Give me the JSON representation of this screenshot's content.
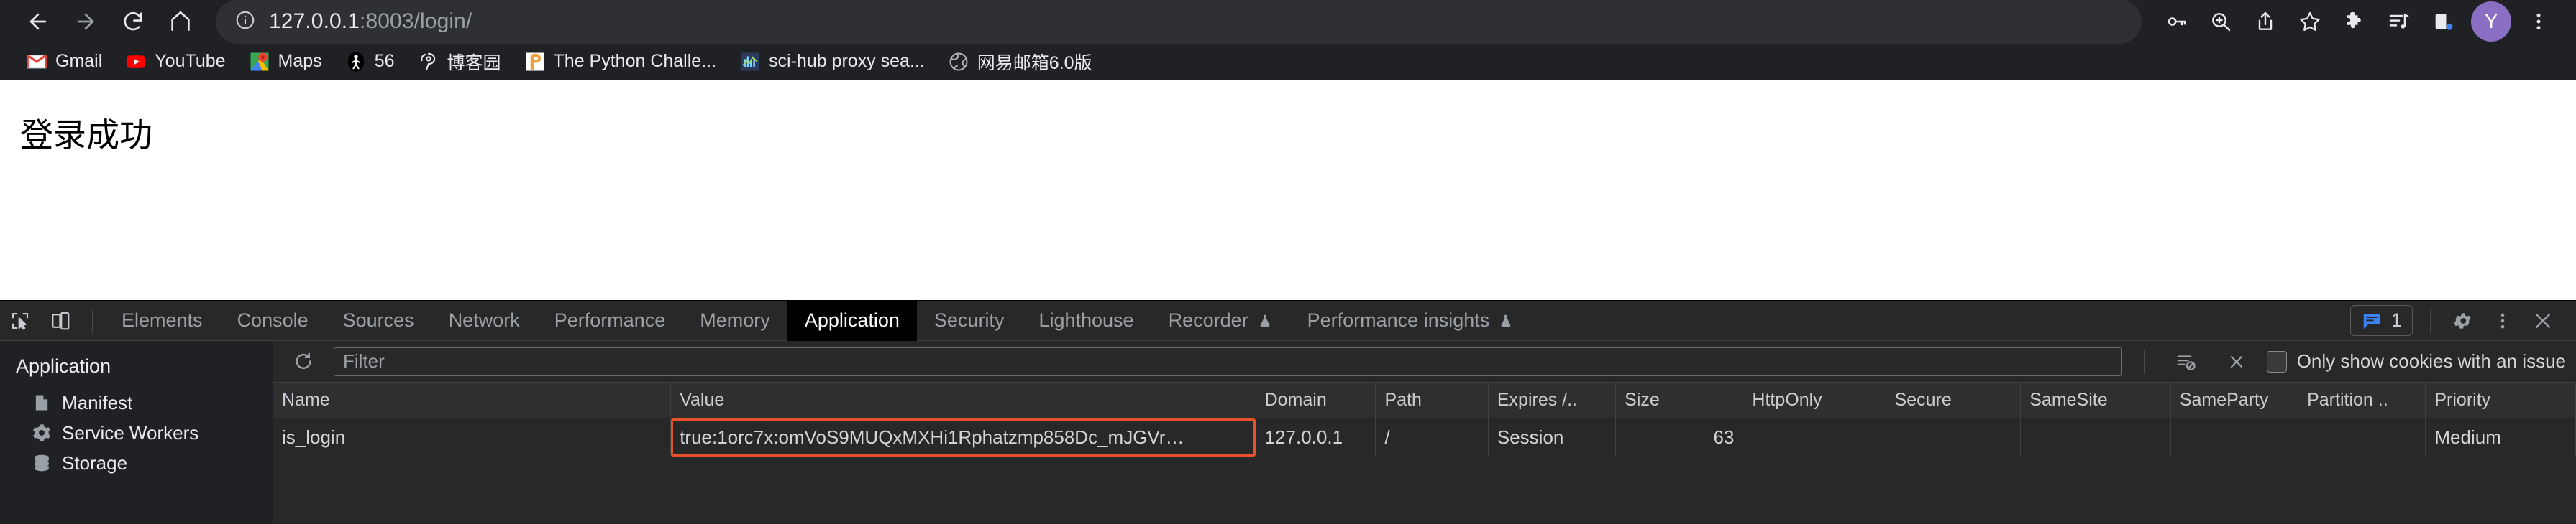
{
  "browser": {
    "nav": {
      "back": "back-icon",
      "forward": "forward-icon",
      "reload": "reload-icon",
      "home": "home-icon"
    },
    "omnibox": {
      "info_icon": "info-circle-icon",
      "url_host": "127.0.0.1",
      "url_rest": ":8003/login/"
    },
    "actions": [
      {
        "name": "password-key-icon"
      },
      {
        "name": "zoom-search-icon"
      },
      {
        "name": "share-icon"
      },
      {
        "name": "bookmark-star-icon"
      },
      {
        "name": "extensions-puzzle-icon"
      },
      {
        "name": "media-playlist-icon"
      },
      {
        "name": "side-panel-icon"
      }
    ],
    "avatar_letter": "Y",
    "menu_icon": "three-dot-menu-icon",
    "bookmarks": [
      {
        "label": "Gmail",
        "icon": "gmail-icon"
      },
      {
        "label": "YouTube",
        "icon": "youtube-icon"
      },
      {
        "label": "Maps",
        "icon": "google-maps-icon"
      },
      {
        "label": "56",
        "icon": "stickman-icon"
      },
      {
        "label": "博客园",
        "icon": "cnblogs-icon"
      },
      {
        "label": "The Python Challe...",
        "icon": "python-challenge-icon"
      },
      {
        "label": "sci-hub proxy sea...",
        "icon": "scihub-icon"
      },
      {
        "label": "网易邮箱6.0版",
        "icon": "netease-mail-icon"
      }
    ]
  },
  "page": {
    "heading": "登录成功"
  },
  "devtools": {
    "inspect_icon": "inspect-element-icon",
    "device_icon": "device-toolbar-icon",
    "tabs": [
      {
        "label": "Elements",
        "active": false
      },
      {
        "label": "Console",
        "active": false
      },
      {
        "label": "Sources",
        "active": false
      },
      {
        "label": "Network",
        "active": false
      },
      {
        "label": "Performance",
        "active": false
      },
      {
        "label": "Memory",
        "active": false
      },
      {
        "label": "Application",
        "active": true
      },
      {
        "label": "Security",
        "active": false
      },
      {
        "label": "Lighthouse",
        "active": false
      },
      {
        "label": "Recorder",
        "active": false,
        "badge": "experiment-flask-icon"
      },
      {
        "label": "Performance insights",
        "active": false,
        "badge": "experiment-flask-icon"
      }
    ],
    "issues_count": "1",
    "issues_icon": "issues-message-icon",
    "settings_icon": "gear-icon",
    "more_icon": "three-dot-menu-icon",
    "close_icon": "close-icon",
    "sidebar": {
      "title": "Application",
      "items": [
        {
          "label": "Manifest",
          "icon": "manifest-document-icon"
        },
        {
          "label": "Service Workers",
          "icon": "gear-icon"
        },
        {
          "label": "Storage",
          "icon": "database-icon"
        }
      ]
    },
    "cookie_toolbar": {
      "refresh_icon": "refresh-icon",
      "filter_placeholder": "Filter",
      "clear_filtered_icon": "clear-filtered-cookies-icon",
      "delete_icon": "delete-selected-cookie-icon",
      "only_issues_label": "Only show cookies with an issue",
      "only_issues_checked": false
    },
    "cookie_table": {
      "columns": [
        "Name",
        "Value",
        "Domain",
        "Path",
        "Expires /..",
        "Size",
        "HttpOnly",
        "Secure",
        "SameSite",
        "SameParty",
        "Partition ..",
        "Priority"
      ],
      "rows": [
        {
          "name": "is_login",
          "value": "true:1orc7x:omVoS9MUQxMXHi1Rphatzmp858Dc_mJGVr…",
          "domain": "127.0.0.1",
          "path": "/",
          "expires": "Session",
          "size": "63",
          "httponly": "",
          "secure": "",
          "samesite": "",
          "sameparty": "",
          "partition": "",
          "priority": "Medium",
          "highlight_value": true
        }
      ],
      "highlight_color": "#e8512a"
    }
  }
}
